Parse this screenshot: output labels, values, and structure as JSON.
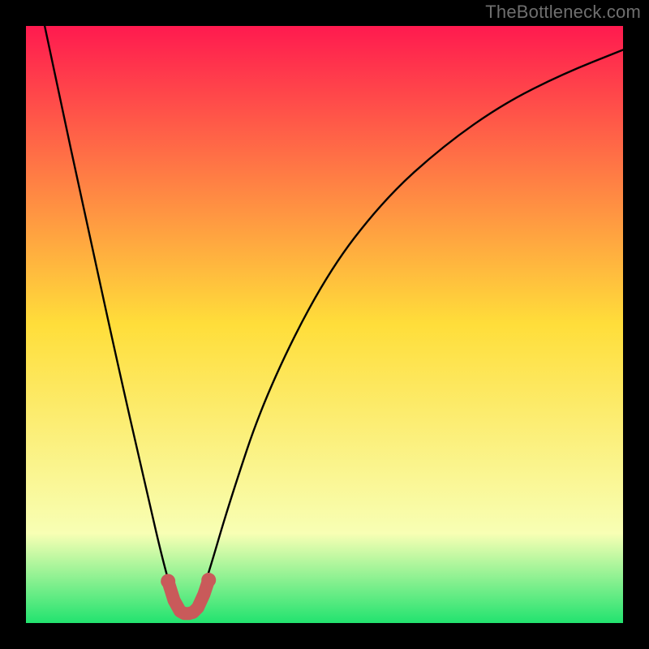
{
  "watermark": "TheBottleneck.com",
  "colors": {
    "page_bg": "#000000",
    "grad_top": "#ff1a4f",
    "grad_mid": "#ffde3a",
    "grad_low": "#f8ffb4",
    "grad_bottom": "#22e36f",
    "curve": "#000000",
    "marker_stroke": "#c95a5a",
    "marker_fill": "#c95a5a"
  },
  "chart_data": {
    "type": "line",
    "title": "",
    "xlabel": "",
    "ylabel": "",
    "xlim": [
      0,
      100
    ],
    "ylim": [
      0,
      100
    ],
    "minimum_x": 27,
    "series": [
      {
        "name": "bottleneck-curve",
        "x": [
          0,
          5,
          10,
          15,
          20,
          23.5,
          25.5,
          27,
          28.5,
          30.5,
          34,
          40,
          50,
          60,
          70,
          80,
          90,
          100
        ],
        "y": [
          115,
          91,
          68,
          45,
          23,
          8,
          2.2,
          1.6,
          2.2,
          8,
          20,
          38,
          58,
          71,
          80,
          87,
          92,
          96
        ]
      }
    ],
    "highlight": {
      "name": "optimal-region",
      "points_x": [
        23.8,
        24.8,
        25.8,
        26.5,
        27.3,
        28.0,
        28.8,
        29.8,
        30.6
      ],
      "points_y": [
        7.0,
        3.8,
        2.0,
        1.6,
        1.6,
        1.8,
        2.6,
        4.8,
        7.2
      ]
    }
  }
}
